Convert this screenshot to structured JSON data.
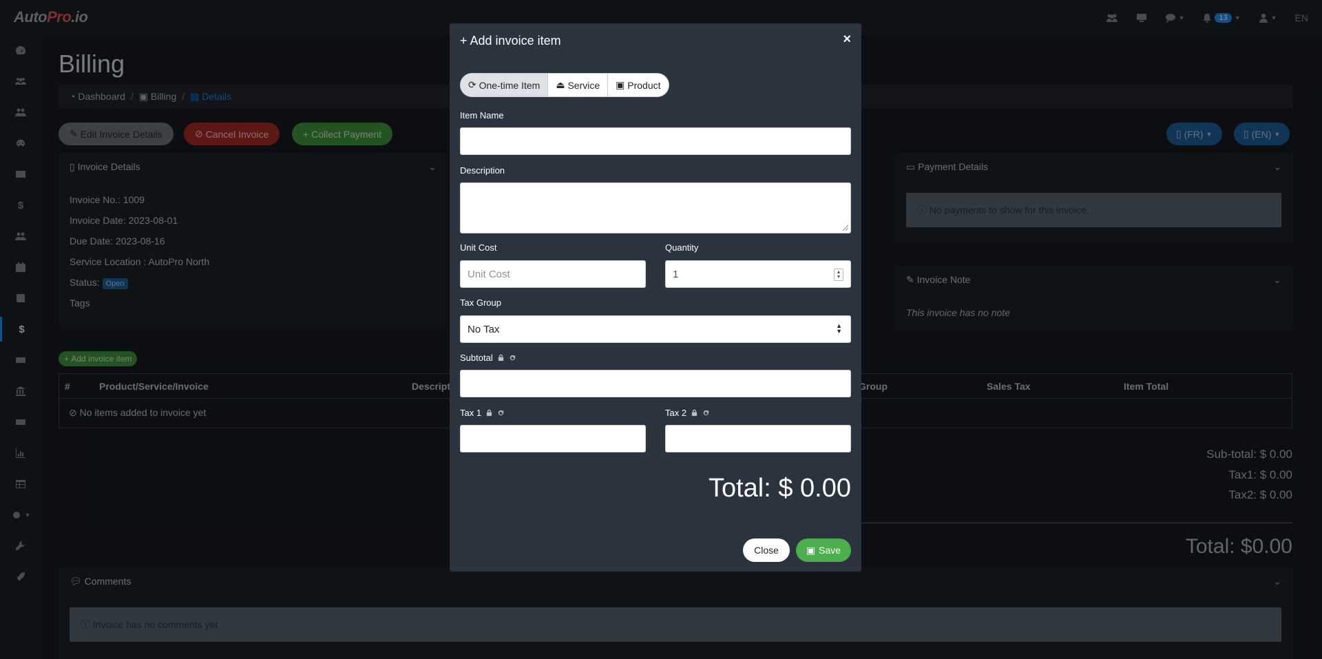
{
  "app": {
    "logo_main": "Auto",
    "logo_pro": "Pro",
    "logo_suffix": ".io"
  },
  "topnav": {
    "notification_count": "13",
    "language": "EN"
  },
  "page": {
    "title": "Billing"
  },
  "breadcrumb": {
    "items": [
      "Dashboard",
      "Billing",
      "Details"
    ],
    "separator": "/"
  },
  "actions": {
    "edit_label": "Edit Invoice Details",
    "cancel_label": "Cancel Invoice",
    "collect_label": "Collect Payment",
    "pdf_fr_label": "(FR)",
    "pdf_en_label": "(EN)"
  },
  "invoice_details": {
    "title": "Invoice Details",
    "number": "Invoice No.: 1009",
    "date": "Invoice Date: 2023-08-01",
    "due": "Due Date: 2023-08-16",
    "location": "Service Location : AutoPro North",
    "status_label": "Status:",
    "status_value": "Open",
    "tags_label": "Tags"
  },
  "payment_details": {
    "title": "Payment Details",
    "empty": "No payments to show for this invoice."
  },
  "invoice_note": {
    "title": "Invoice Note",
    "empty": "This invoice has no note"
  },
  "items": {
    "add_label": "Add invoice item",
    "columns": [
      "#",
      "Product/Service/Invoice",
      "Descript",
      "Group",
      "Sales Tax",
      "Item Total"
    ],
    "empty": "No items added to invoice yet"
  },
  "totals": {
    "subtotal": "Sub-total: $ 0.00",
    "tax1": "Tax1: $ 0.00",
    "tax2": "Tax2: $ 0.00",
    "total": "Total: $0.00"
  },
  "comments": {
    "title": "Comments",
    "empty": "Invoice has no comments yet"
  },
  "modal": {
    "title": "Add invoice item",
    "close_glyph": "×",
    "tabs": [
      "One-time Item",
      "Service",
      "Product"
    ],
    "active_tab": "One-time Item",
    "item_name_label": "Item Name",
    "item_name_value": "",
    "description_label": "Description",
    "description_value": "",
    "unit_cost_label": "Unit Cost",
    "unit_cost_placeholder": "Unit Cost",
    "quantity_label": "Quantity",
    "quantity_value": "1",
    "tax_group_label": "Tax Group",
    "tax_group_value": "No Tax",
    "subtotal_label": "Subtotal",
    "subtotal_value": "",
    "tax1_label": "Tax 1",
    "tax1_value": "",
    "tax2_label": "Tax 2",
    "tax2_value": "",
    "total": "Total: $ 0.00",
    "close_label": "Close",
    "save_label": "Save"
  }
}
